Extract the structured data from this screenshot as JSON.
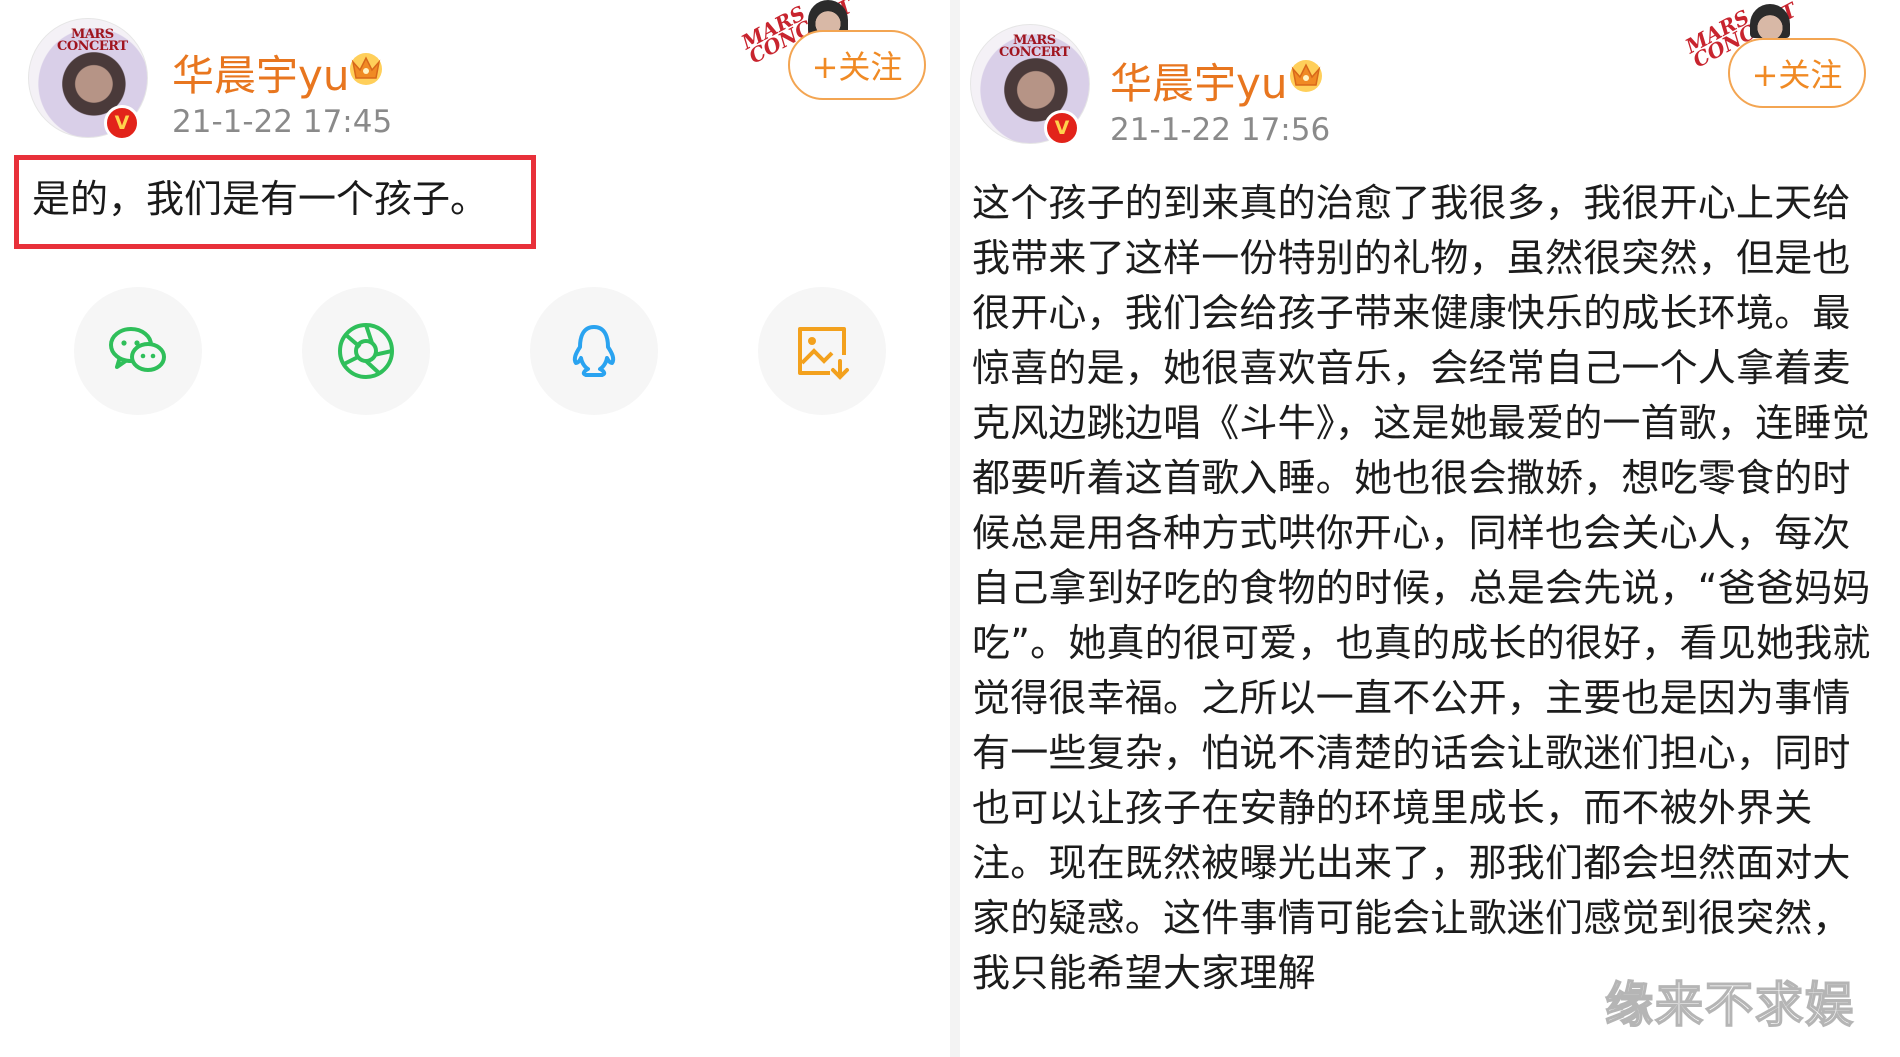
{
  "left_post": {
    "user_name": "华晨宇yu",
    "timestamp": "21-1-22  17:45",
    "follow_label": "+关注",
    "body": "是的，我们是有一个孩子。",
    "avatar_poster_text": "MARS\nCONCERT"
  },
  "right_post": {
    "user_name": "华晨宇yu",
    "timestamp": "21-1-22  17:56",
    "follow_label": "+关注",
    "body": "这个孩子的到来真的治愈了我很多，我很开心上天给我带来了这样一份特别的礼物，虽然很突然，但是也很开心，我们会给孩子带来健康快乐的成长环境。最惊喜的是，她很喜欢音乐，会经常自己一个人拿着麦克风边跳边唱《斗牛》，这是她最爱的一首歌，连睡觉都要听着这首歌入睡。她也很会撒娇，想吃零食的时候总是用各种方式哄你开心，同样也会关心人，每次自己拿到好吃的食物的时候，总是会先说，“爸爸妈妈吃”。她真的很可爱，也真的成长的很好，看见她我就觉得很幸福。之所以一直不公开，主要也是因为事情有一些复杂，怕说不清楚的话会让歌迷们担心，同时也可以让孩子在安静的环境里成长，而不被外界关注。现在既然被曝光出来了，那我们都会坦然面对大家的疑惑。这件事情可能会让歌迷们感觉到很突然，我只能希望大家理解",
    "avatar_poster_text": "MARS\nCONCERT"
  },
  "share_icons": [
    "wechat-icon",
    "moments-icon",
    "qq-icon",
    "save-image-icon"
  ],
  "watermark": "缘来不求娱",
  "colors": {
    "name": "#e8761f",
    "follow_border": "#f3a552",
    "highlight": "#e8303a",
    "vip_badge": "#e2231a",
    "wechat": "#2fbf5a",
    "qq": "#2aa3f0",
    "save": "#f3a11d"
  }
}
